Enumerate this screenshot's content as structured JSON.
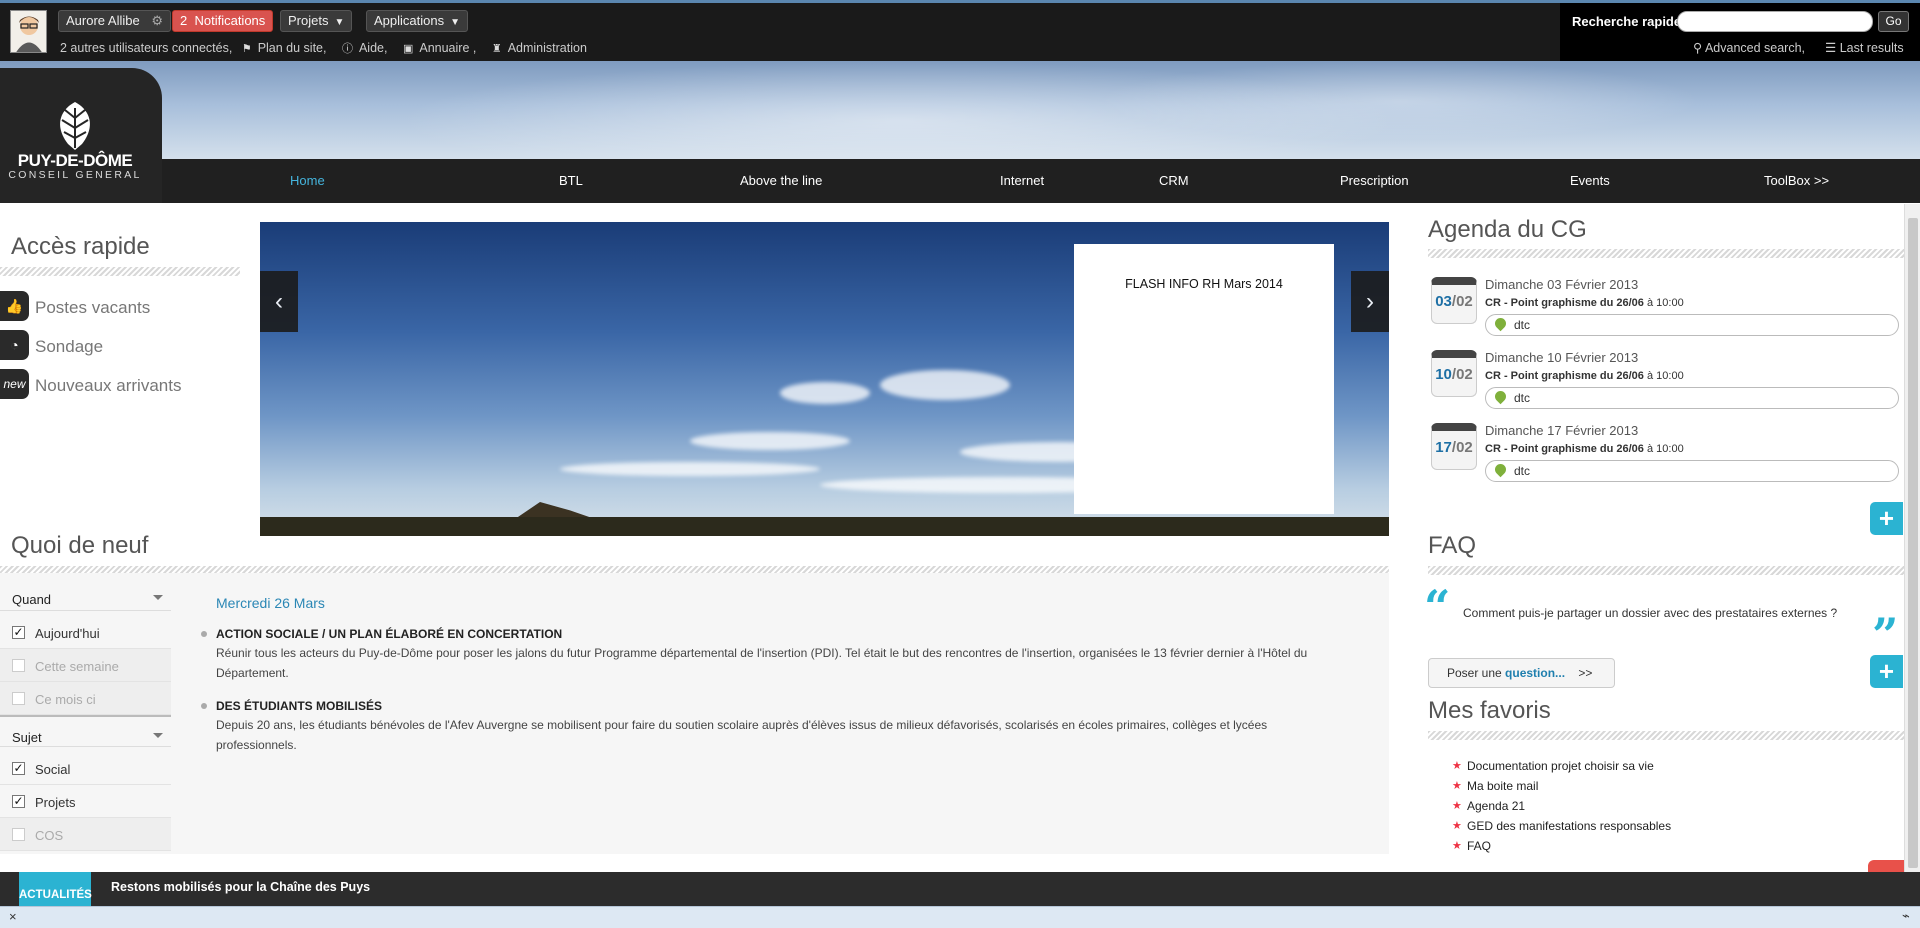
{
  "topbar": {
    "user_name": "Aurore Allibe",
    "notifications_count": "2",
    "notifications_label": "Notifications",
    "projets_label": "Projets",
    "applications_label": "Applications",
    "connected_users": "2 autres utilisateurs connectés,",
    "links": {
      "plan": "Plan du site,",
      "aide": "Aide,",
      "annuaire": "Annuaire ,",
      "admin": "Administration"
    }
  },
  "search": {
    "label": "Recherche rapide",
    "placeholder": "",
    "go": "Go",
    "advanced": "Advanced search,",
    "last": "Last results"
  },
  "logo": {
    "line1": "PUY-DE-DÔME",
    "line2": "CONSEIL GENERAL"
  },
  "nav": [
    "Home",
    "BTL",
    "Above the line",
    "Internet",
    "CRM",
    "Prescription",
    "Events",
    "ToolBox >>"
  ],
  "acces_rapide": {
    "title": "Accès rapide",
    "items": [
      {
        "label": "Postes vacants",
        "icon": "thumbs-up-icon"
      },
      {
        "label": "Sondage",
        "icon": "pie-chart-icon"
      },
      {
        "label": "Nouveaux arrivants",
        "icon": "new-badge-icon",
        "glyph": "new"
      }
    ]
  },
  "slider": {
    "flash": "FLASH INFO RH Mars 2014"
  },
  "agenda": {
    "title": "Agenda du CG",
    "events": [
      {
        "day": "03",
        "month": "/02",
        "date": "Dimanche 03 Février 2013",
        "title": "CR - Point graphisme du 26/06",
        "time": "à 10:00",
        "place": "dtc"
      },
      {
        "day": "10",
        "month": "/02",
        "date": "Dimanche 10 Février 2013",
        "title": "CR - Point graphisme du 26/06",
        "time": "à 10:00",
        "place": "dtc"
      },
      {
        "day": "17",
        "month": "/02",
        "date": "Dimanche 17 Février 2013",
        "title": "CR - Point graphisme du 26/06",
        "time": "à 10:00",
        "place": "dtc"
      }
    ]
  },
  "quoi_de_neuf": {
    "title": "Quoi de neuf",
    "filter_quand": "Quand",
    "quand_options": [
      {
        "label": "Aujourd'hui",
        "checked": true
      },
      {
        "label": "Cette semaine",
        "checked": false
      },
      {
        "label": "Ce mois ci",
        "checked": false
      }
    ],
    "filter_sujet": "Sujet",
    "sujet_options": [
      {
        "label": "Social",
        "checked": true
      },
      {
        "label": "Projets",
        "checked": true
      },
      {
        "label": "COS",
        "checked": false
      }
    ],
    "date": "Mercredi 26 Mars",
    "items": [
      {
        "title": "Action sociale / Un plan élaboré en concertation",
        "text": "Réunir tous les acteurs du Puy-de-Dôme pour poser les jalons du futur Programme départemental de l'insertion (PDI). Tel était le but des rencontres de l'insertion, organisées le 13 février dernier à l'Hôtel du Département."
      },
      {
        "title": "Des étudiants mobilisés",
        "text": "Depuis 20 ans, les étudiants bénévoles de l'Afev Auvergne se mobilisent pour faire du soutien scolaire auprès d'élèves issus de milieux défavorisés, scolarisés en écoles primaires, collèges et lycées professionnels."
      }
    ]
  },
  "faq": {
    "title": "FAQ",
    "question": "Comment puis-je partager un dossier avec des prestataires externes ?",
    "ask_prefix": "Poser une",
    "ask_link": "question...",
    "ask_arrow": ">>"
  },
  "favoris": {
    "title": "Mes favoris",
    "items": [
      "Documentation projet choisir sa vie",
      "Ma boite mail",
      "Agenda 21",
      "GED des manifestations responsables",
      "FAQ"
    ]
  },
  "ticker": {
    "label": "ACTUALITÉS",
    "text": "Restons mobilisés pour la Chaîne des Puys"
  },
  "status": {
    "close": "×"
  },
  "colors": {
    "accent": "#2bb3d2",
    "nav_active": "#45b4dc",
    "notif": "#d9534f",
    "link": "#2b87b5"
  }
}
